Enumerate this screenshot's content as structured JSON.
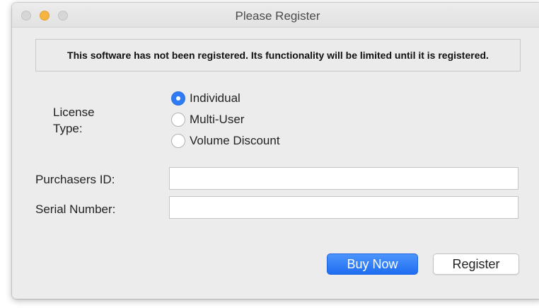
{
  "window": {
    "title": "Please Register"
  },
  "banner": {
    "message": "This software has not been registered.  Its functionality will be limited until it is registered."
  },
  "license": {
    "label_line1": "License",
    "label_line2": "Type:",
    "options": [
      {
        "label": "Individual",
        "checked": true
      },
      {
        "label": "Multi-User",
        "checked": false
      },
      {
        "label": "Volume Discount",
        "checked": false
      }
    ]
  },
  "fields": {
    "purchasers_id": {
      "label": "Purchasers ID:",
      "value": ""
    },
    "serial_number": {
      "label": "Serial Number:",
      "value": ""
    }
  },
  "buttons": {
    "buy_now": "Buy Now",
    "register": "Register"
  },
  "colors": {
    "accent": "#2f7bf6",
    "window_bg": "#ececec",
    "minimize": "#f5b53f"
  },
  "icons": {
    "close": "close-icon",
    "minimize": "minimize-icon",
    "zoom": "zoom-icon"
  }
}
